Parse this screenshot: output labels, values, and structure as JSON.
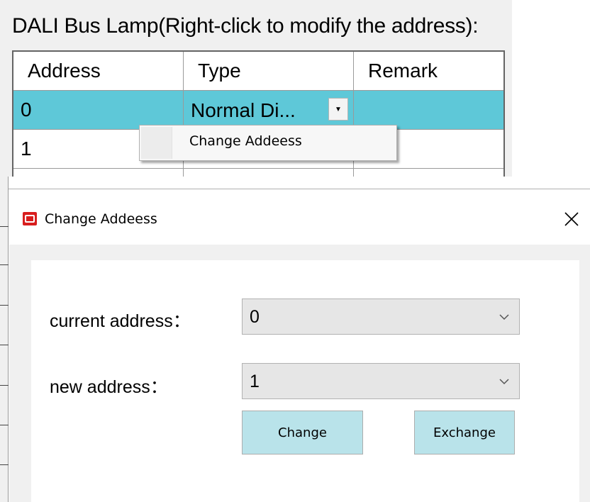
{
  "panel": {
    "label": "DALI Bus Lamp(Right-click to modify the address):",
    "columns": [
      "Address",
      "Type",
      "Remark"
    ],
    "rows": [
      {
        "address": "0",
        "type": "Normal Di...",
        "remark": ""
      },
      {
        "address": "1",
        "type": "",
        "remark": ""
      }
    ],
    "context_menu": [
      "Change Addeess"
    ]
  },
  "dialog": {
    "title": "Change Addeess",
    "icon": "app-logo-icon",
    "current_address_label": "current address：",
    "current_address_value": "0",
    "new_address_label": "new address：",
    "new_address_value": "1",
    "change_label": "Change",
    "exchange_label": "Exchange"
  },
  "colors": {
    "selection": "#5ec8d8",
    "button": "#b9e3ea",
    "app_icon": "#d81e1e"
  }
}
